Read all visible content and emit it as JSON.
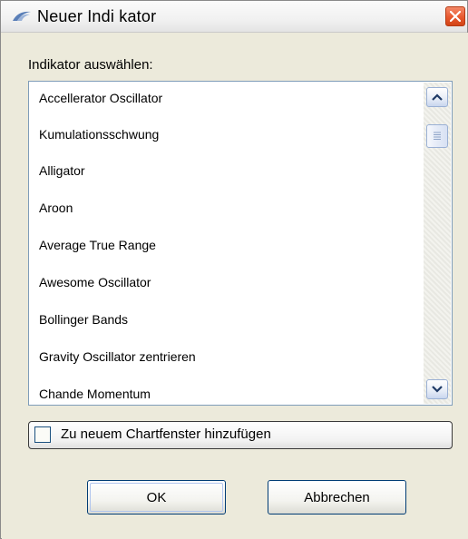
{
  "window": {
    "title": "Neuer Indi kator",
    "logo_icon": "app-logo-icon",
    "close_icon": "close-icon"
  },
  "indicator_section": {
    "label": "Indikator auswählen:"
  },
  "indicator_list": {
    "items": [
      "Accellerator Oscillator",
      "Kumulationsschwung",
      "Alligator",
      "Aroon",
      "Average True Range",
      "Awesome Oscillator",
      "Bollinger Bands",
      "Gravity Oscillator zentrieren",
      "Chande Momentum"
    ]
  },
  "scrollbar": {
    "up_icon": "chevron-up-icon",
    "down_icon": "chevron-down-icon",
    "thumb_icon": "grip-icon"
  },
  "new_chart_option": {
    "label": "Zu neuem Chartfenster hinzufügen",
    "checked": false
  },
  "buttons": {
    "ok_label": "OK",
    "cancel_label": "Abbrechen"
  },
  "colors": {
    "window_bg": "#eceadb",
    "close_button": "#e8582e",
    "list_border": "#7f9db9",
    "button_border": "#003c74"
  }
}
